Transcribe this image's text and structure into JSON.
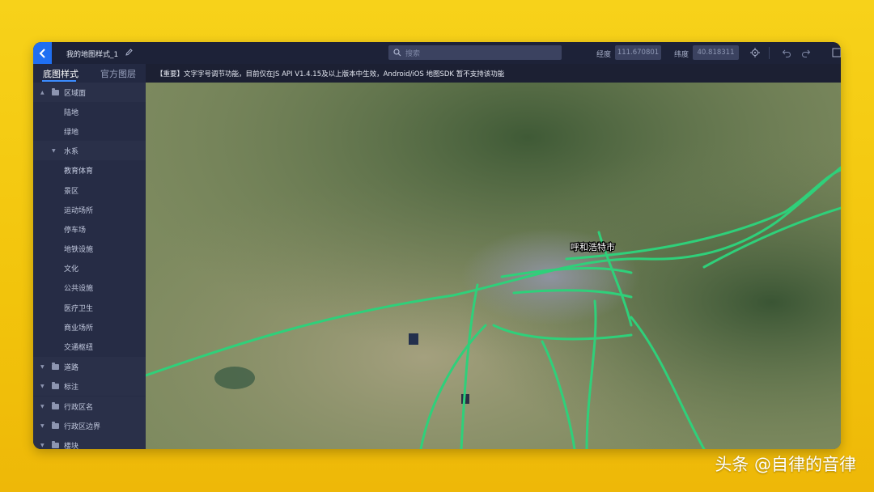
{
  "app": {
    "map_name": "我的地图样式_1",
    "search_placeholder": "搜索",
    "lng_label": "经度",
    "lng_value": "111.670801",
    "lat_label": "纬度",
    "lat_value": "40.818311",
    "accent": "#1f6ff2"
  },
  "tabs": [
    {
      "label": "底图样式",
      "active": true
    },
    {
      "label": "官方图层",
      "active": false
    }
  ],
  "notice": "【重要】文字字号调节功能，目前仅在JS API V1.4.15及以上版本中生效，Android/iOS 地图SDK 暂不支持该功能",
  "sidebar": {
    "items": [
      {
        "label": "区域面",
        "level": 0,
        "expanded": true
      },
      {
        "label": "陆地",
        "level": 1
      },
      {
        "label": "绿地",
        "level": 1
      },
      {
        "label": "水系",
        "level": 1,
        "expanded": true
      },
      {
        "label": "教育体育",
        "level": 1
      },
      {
        "label": "景区",
        "level": 1
      },
      {
        "label": "运动场所",
        "level": 1
      },
      {
        "label": "停车场",
        "level": 1
      },
      {
        "label": "地铁设施",
        "level": 1
      },
      {
        "label": "文化",
        "level": 1
      },
      {
        "label": "公共设施",
        "level": 1
      },
      {
        "label": "医疗卫生",
        "level": 1
      },
      {
        "label": "商业场所",
        "level": 1
      },
      {
        "label": "交通枢纽",
        "level": 1
      },
      {
        "label": "道路",
        "level": 0,
        "expanded": false
      },
      {
        "label": "标注",
        "level": 0,
        "expanded": false
      },
      {
        "label": "行政区名",
        "level": 0,
        "expanded": false
      },
      {
        "label": "行政区边界",
        "level": 0,
        "expanded": false
      },
      {
        "label": "楼块",
        "level": 0,
        "expanded": false
      }
    ]
  },
  "map": {
    "city_label": "呼和浩特市",
    "road_color": "#2fd07a"
  },
  "watermark": "头条 @自律的音律"
}
